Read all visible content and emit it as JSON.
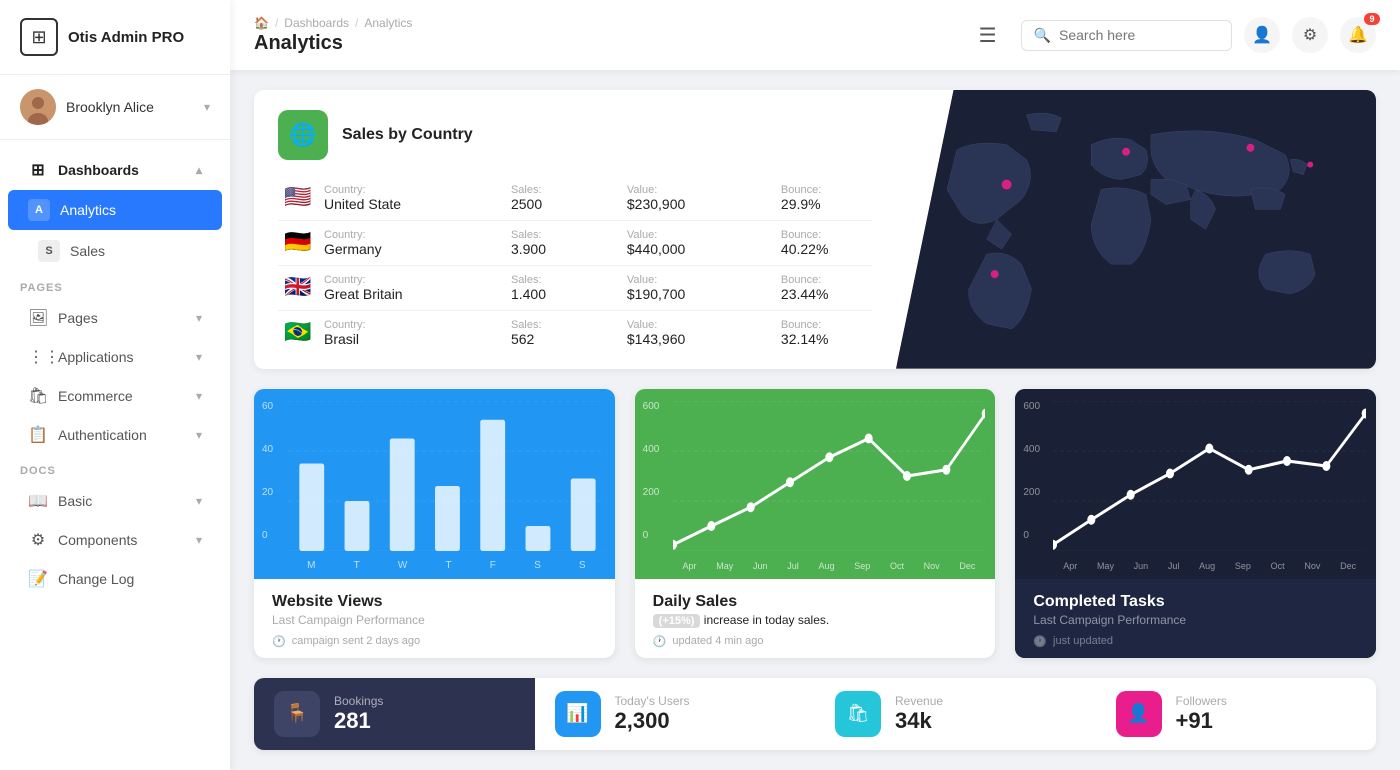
{
  "app": {
    "name": "Otis Admin PRO",
    "logo_symbol": "⊞"
  },
  "user": {
    "name": "Brooklyn Alice",
    "avatar_initial": "B"
  },
  "sidebar": {
    "nav_items": [
      {
        "id": "dashboards",
        "label": "Dashboards",
        "icon": "⊞",
        "type": "parent",
        "expanded": true
      },
      {
        "id": "analytics",
        "label": "Analytics",
        "icon": "A",
        "type": "child",
        "active": true
      },
      {
        "id": "sales",
        "label": "Sales",
        "icon": "S",
        "type": "child"
      }
    ],
    "pages_label": "PAGES",
    "page_items": [
      {
        "id": "pages",
        "label": "Pages",
        "icon": "🖼"
      },
      {
        "id": "applications",
        "label": "Applications",
        "icon": "⋮⋮"
      },
      {
        "id": "ecommerce",
        "label": "Ecommerce",
        "icon": "🛍"
      },
      {
        "id": "authentication",
        "label": "Authentication",
        "icon": "📋"
      }
    ],
    "docs_label": "DOCS",
    "doc_items": [
      {
        "id": "basic",
        "label": "Basic",
        "icon": "📖"
      },
      {
        "id": "components",
        "label": "Components",
        "icon": "⚙"
      },
      {
        "id": "changelog",
        "label": "Change Log",
        "icon": "📝"
      }
    ]
  },
  "header": {
    "breadcrumb": [
      "🏠",
      "Dashboards",
      "Analytics"
    ],
    "title": "Analytics",
    "search_placeholder": "Search here",
    "notif_count": "9"
  },
  "sales_by_country": {
    "title": "Sales by Country",
    "columns": {
      "country": "Country:",
      "sales": "Sales:",
      "value": "Value:",
      "bounce": "Bounce:"
    },
    "rows": [
      {
        "flag": "🇺🇸",
        "country": "United State",
        "sales": "2500",
        "value": "$230,900",
        "bounce": "29.9%"
      },
      {
        "flag": "🇩🇪",
        "country": "Germany",
        "sales": "3.900",
        "value": "$440,000",
        "bounce": "40.22%"
      },
      {
        "flag": "🇬🇧",
        "country": "Great Britain",
        "sales": "1.400",
        "value": "$190,700",
        "bounce": "23.44%"
      },
      {
        "flag": "🇧🇷",
        "country": "Brasil",
        "sales": "562",
        "value": "$143,960",
        "bounce": "32.14%"
      }
    ]
  },
  "charts": {
    "website_views": {
      "title": "Website Views",
      "description": "Last Campaign Performance",
      "footer": "campaign sent 2 days ago",
      "y_labels": [
        "60",
        "40",
        "20",
        "0"
      ],
      "x_labels": [
        "M",
        "T",
        "W",
        "T",
        "F",
        "S",
        "S"
      ],
      "bars": [
        35,
        20,
        45,
        25,
        55,
        10,
        30
      ]
    },
    "daily_sales": {
      "title": "Daily Sales",
      "increase_badge": "(+15%)",
      "description": "increase in today sales.",
      "footer": "updated 4 min ago",
      "y_labels": [
        "600",
        "400",
        "200",
        "0"
      ],
      "x_labels": [
        "Apr",
        "May",
        "Jun",
        "Jul",
        "Aug",
        "Sep",
        "Oct",
        "Nov",
        "Dec"
      ],
      "points": [
        20,
        80,
        160,
        280,
        380,
        440,
        260,
        300,
        460
      ]
    },
    "completed_tasks": {
      "title": "Completed Tasks",
      "description": "Last Campaign Performance",
      "footer": "just updated",
      "y_labels": [
        "600",
        "400",
        "200",
        "0"
      ],
      "x_labels": [
        "Apr",
        "May",
        "Jun",
        "Jul",
        "Aug",
        "Sep",
        "Oct",
        "Nov",
        "Dec"
      ],
      "points": [
        20,
        100,
        180,
        240,
        360,
        280,
        320,
        300,
        460
      ]
    }
  },
  "stats": [
    {
      "icon": "🪑",
      "icon_class": "stat-icon-dark",
      "label": "Bookings",
      "value": "281"
    },
    {
      "icon": "📊",
      "icon_class": "stat-icon-blue",
      "label": "Today's Users",
      "value": "2,300"
    },
    {
      "icon": "🛍",
      "icon_class": "stat-icon-teal",
      "label": "Revenue",
      "value": "34k"
    },
    {
      "icon": "👤",
      "icon_class": "stat-icon-pink",
      "label": "Followers",
      "value": "+91"
    }
  ]
}
